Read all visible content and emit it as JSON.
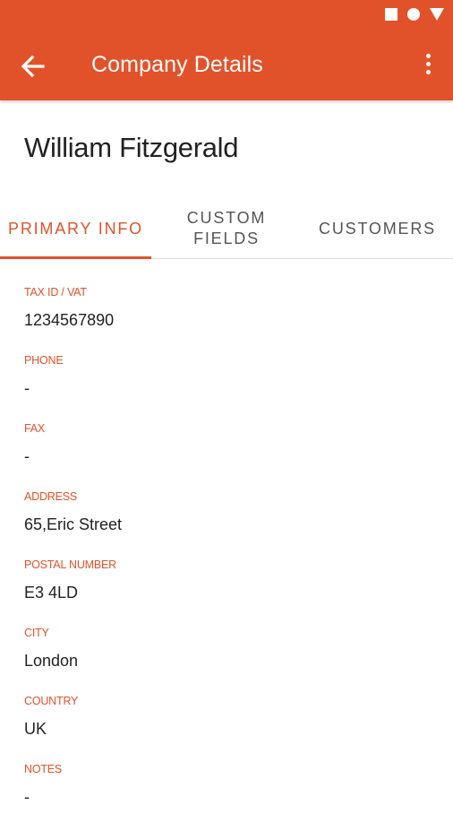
{
  "colors": {
    "accent": "#E2522A",
    "text": "#222222",
    "tab_inactive": "#555555"
  },
  "status_bar": {
    "icons": [
      "square-icon",
      "circle-icon",
      "triangle-icon"
    ]
  },
  "app_bar": {
    "title": "Company Details",
    "back_icon": "arrow-left-icon",
    "menu_icon": "more-vertical-icon"
  },
  "company": {
    "name": "William Fitzgerald"
  },
  "tabs": [
    {
      "label": "PRIMARY INFO",
      "active": true
    },
    {
      "label": "CUSTOM FIELDS",
      "active": false
    },
    {
      "label": "CUSTOMERS",
      "active": false
    }
  ],
  "fields": [
    {
      "label": "TAX ID / VAT",
      "value": "1234567890"
    },
    {
      "label": "PHONE",
      "value": "-"
    },
    {
      "label": "FAX",
      "value": "-"
    },
    {
      "label": "ADDRESS",
      "value": "65,Eric Street"
    },
    {
      "label": "POSTAL NUMBER",
      "value": "E3 4LD"
    },
    {
      "label": "CITY",
      "value": "London"
    },
    {
      "label": "COUNTRY",
      "value": "UK"
    },
    {
      "label": "NOTES",
      "value": "-"
    }
  ]
}
